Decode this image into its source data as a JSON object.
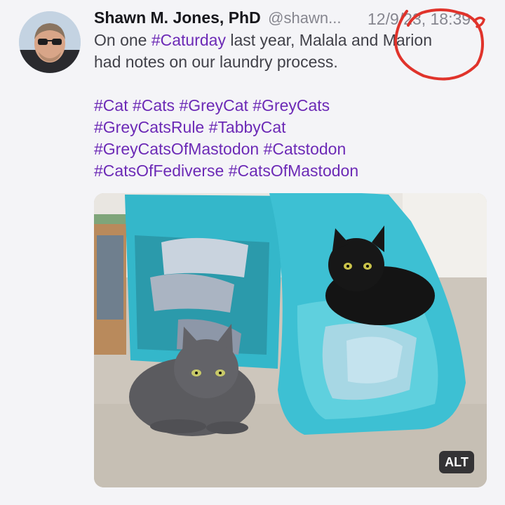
{
  "post": {
    "display_name": "Shawn M. Jones, PhD",
    "handle": "@shawn...",
    "timestamp": "12/9/23, 18:39",
    "text_line1_pre": "On one ",
    "text_line1_tag": "#Caturday",
    "text_line1_post": " last year, Malala and Marion",
    "text_line2": "had notes on our laundry process.",
    "hashtag_lines": [
      "#Cat #Cats #GreyCat #GreyCats",
      "#GreyCatsRule #TabbyCat",
      "#GreyCatsOfMastodon #Catstodon",
      "#CatsOfFediverse #CatsOfMastodon"
    ]
  },
  "media": {
    "alt_label": "ALT"
  },
  "colors": {
    "hashtag": "#6c2ab6",
    "annotation": "#e0332b",
    "hamper": "#33b9cc"
  },
  "icons": {
    "avatar": "profile-photo",
    "annotation": "red-hand-drawn-circle"
  }
}
